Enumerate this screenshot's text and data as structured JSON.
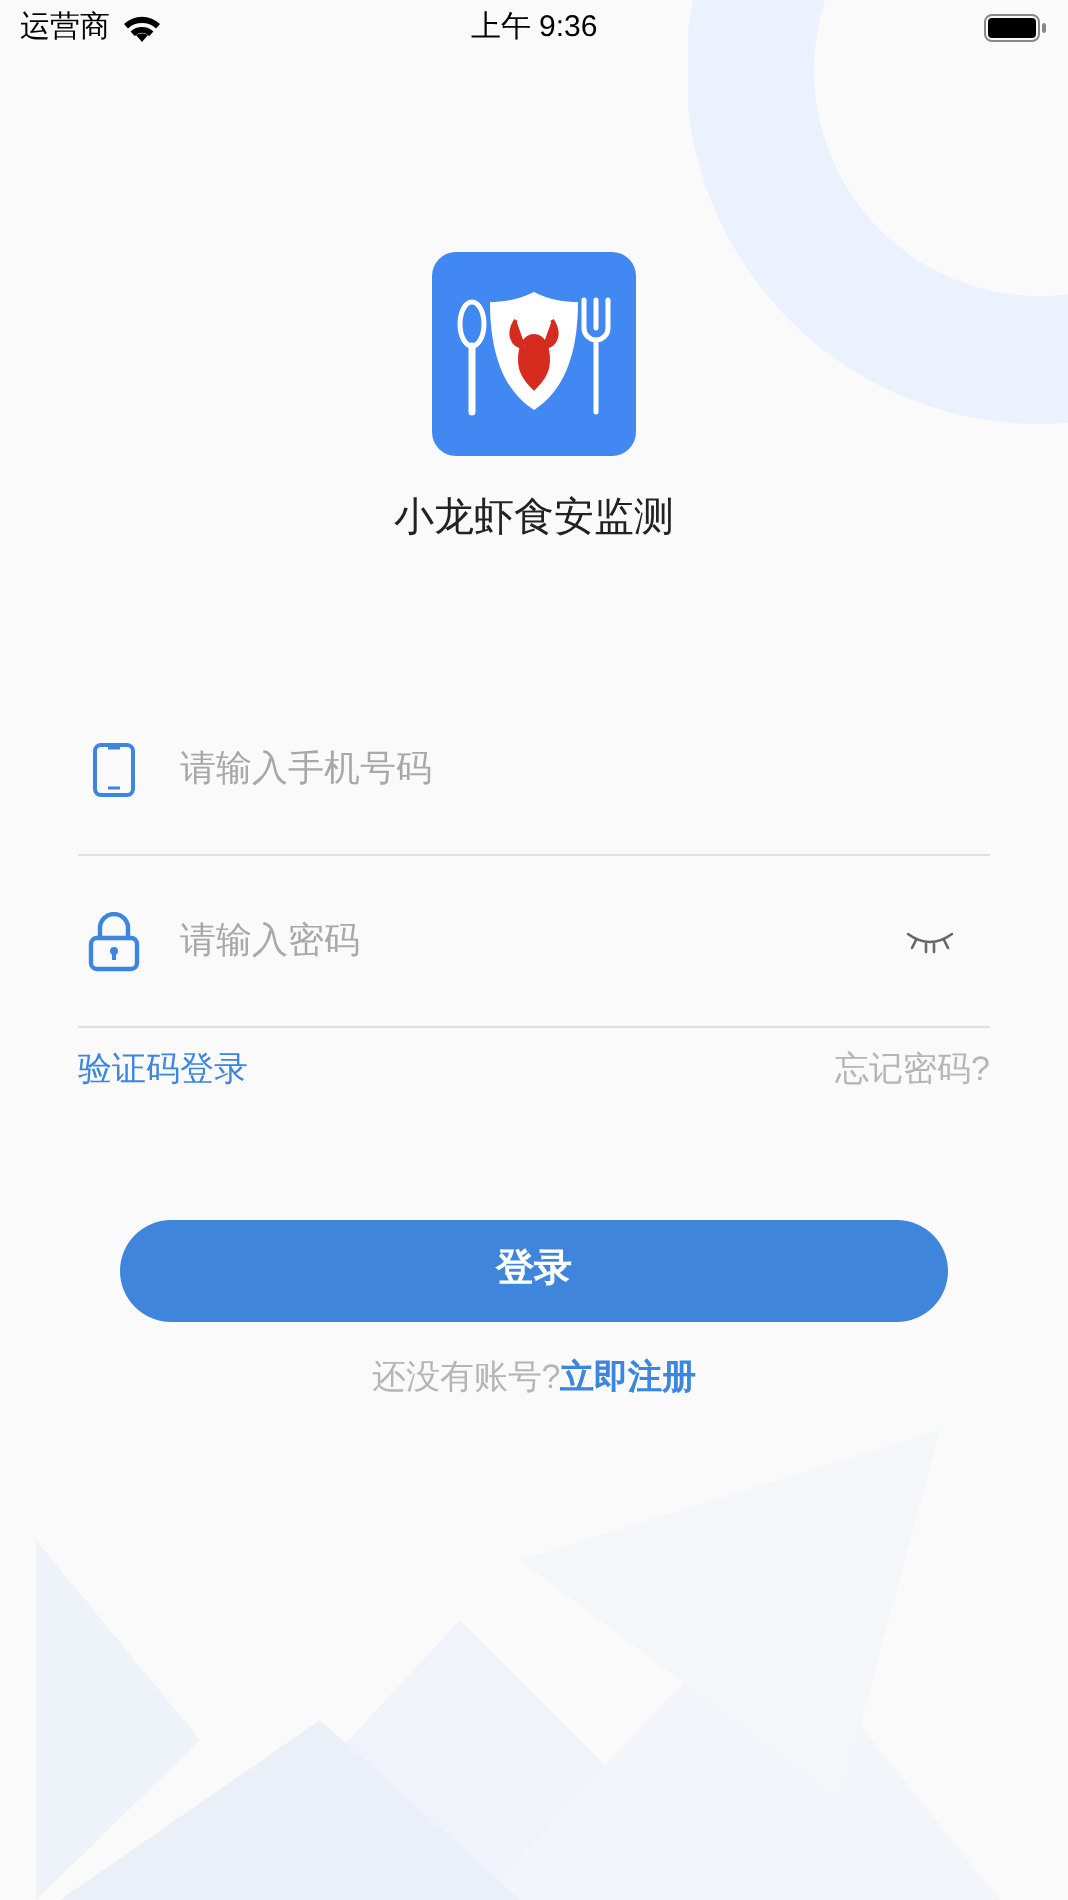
{
  "status_bar": {
    "carrier": "运营商",
    "time": "上午 9:36"
  },
  "app": {
    "name": "小龙虾食安监测"
  },
  "fields": [
    {
      "kind": "phone",
      "placeholder": "请输入手机号码"
    },
    {
      "kind": "password",
      "placeholder": "请输入密码"
    }
  ],
  "links": {
    "sms_login": "验证码登录",
    "forgot": "忘记密码?"
  },
  "login_button": "登录",
  "register": {
    "prompt": "还没有账号?",
    "link": "立即注册"
  }
}
